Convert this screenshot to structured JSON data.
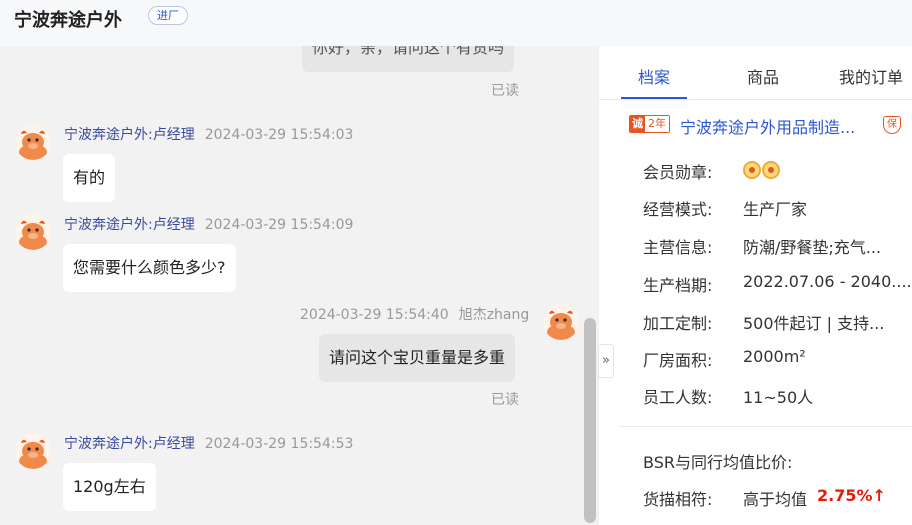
{
  "header": {
    "title": "宁波奔途户外",
    "badge": "进厂"
  },
  "chat": {
    "partial_message": "你好，亲，请问这个有货吗",
    "read_label": "已读",
    "messages": [
      {
        "sender": "宁波奔途户外:卢经理",
        "time": "2024-03-29 15:54:03",
        "text": "有的",
        "mine": false
      },
      {
        "sender": "宁波奔途户外:卢经理",
        "time": "2024-03-29 15:54:09",
        "text": "您需要什么颜色多少?",
        "mine": false
      },
      {
        "sender": "旭杰zhang",
        "time": "2024-03-29 15:54:40",
        "text": "请问这个宝贝重量是多重",
        "mine": true
      },
      {
        "sender": "宁波奔途户外:卢经理",
        "time": "2024-03-29 15:54:53",
        "text": "120g左右",
        "mine": false
      }
    ]
  },
  "panel": {
    "tabs": [
      "档案",
      "商品",
      "我的订单"
    ],
    "company": {
      "badge_icon": "诚",
      "badge_years": "2年",
      "name": "宁波奔途户外用品制造...",
      "guarantee": "保"
    },
    "info": [
      {
        "label": "会员勋章:",
        "value": ""
      },
      {
        "label": "经营模式:",
        "value": "生产厂家"
      },
      {
        "label": "主营信息:",
        "value": "防潮/野餐垫;充气..."
      },
      {
        "label": "生产档期:",
        "value": "2022.07.06 - 2040...."
      },
      {
        "label": "加工定制:",
        "value": "500件起订 | 支持..."
      },
      {
        "label": "厂房面积:",
        "value": "2000m²"
      },
      {
        "label": "员工人数:",
        "value": "11~50人"
      }
    ],
    "bsr_title": "BSR与同行均值比价:",
    "match": {
      "label": "货描相符:",
      "value": "高于均值",
      "percent": "2.75%↑"
    }
  },
  "colors": {
    "accent": "#2d57d1",
    "brand_orange": "#e8541e",
    "up_red": "#e8190b"
  },
  "icons": {
    "avatar": "cartoon-bull-avatar",
    "collapse": "double-chevron-right-icon",
    "medal": "medal-icon",
    "guarantee": "shield-guarantee-icon"
  }
}
